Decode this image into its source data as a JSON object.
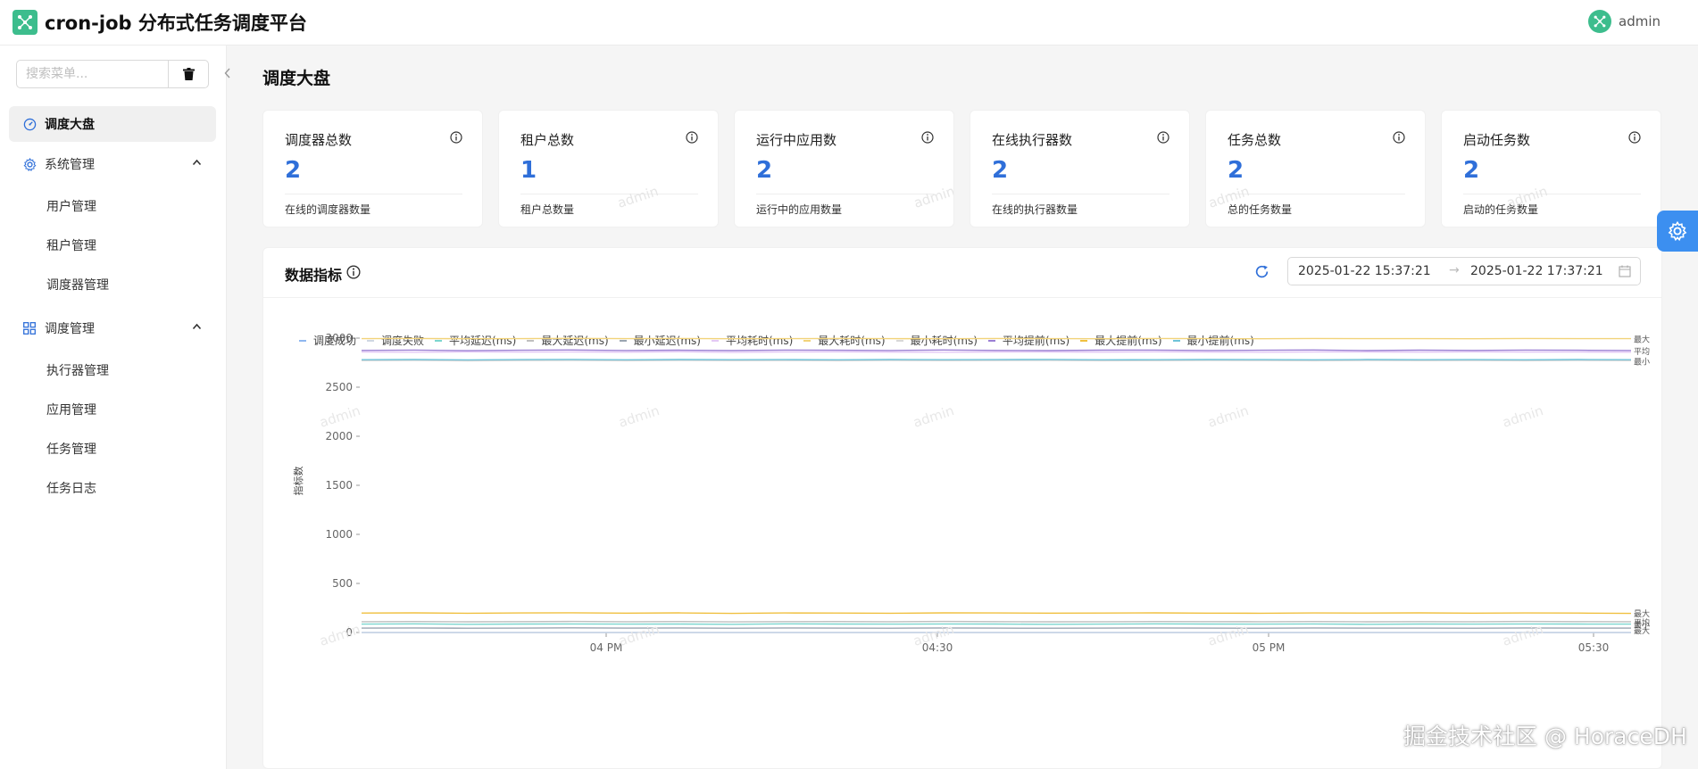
{
  "header": {
    "title": "cron-job 分布式任务调度平台",
    "user": "admin"
  },
  "sidebar": {
    "search_placeholder": "搜索菜单...",
    "items": [
      {
        "label": "调度大盘",
        "icon": "dashboard-icon",
        "active": true
      },
      {
        "label": "系统管理",
        "icon": "gear-icon",
        "expanded": true,
        "children": [
          "用户管理",
          "租户管理",
          "调度器管理"
        ]
      },
      {
        "label": "调度管理",
        "icon": "grid-icon",
        "expanded": true,
        "children": [
          "执行器管理",
          "应用管理",
          "任务管理",
          "任务日志"
        ]
      }
    ]
  },
  "page": {
    "title": "调度大盘"
  },
  "stat_cards": [
    {
      "title": "调度器总数",
      "value": "2",
      "desc": "在线的调度器数量"
    },
    {
      "title": "租户总数",
      "value": "1",
      "desc": "租户总数量"
    },
    {
      "title": "运行中应用数",
      "value": "2",
      "desc": "运行中的应用数量"
    },
    {
      "title": "在线执行器数",
      "value": "2",
      "desc": "在线的执行器数量"
    },
    {
      "title": "任务总数",
      "value": "2",
      "desc": "总的任务数量"
    },
    {
      "title": "启动任务数",
      "value": "2",
      "desc": "启动的任务数量"
    }
  ],
  "watermark": "admin",
  "metrics": {
    "title": "数据指标",
    "range_start": "2025-01-22 15:37:21",
    "range_separator": "→",
    "range_end": "2025-01-22 17:37:21"
  },
  "credit": "掘金技术社区 @ HoraceDH",
  "colors": {
    "accent": "#2f6fd9",
    "brand": "#3dbd8d",
    "fab": "#3c8ff0"
  },
  "chart_data": {
    "type": "line",
    "ylabel": "指标数",
    "ylim": [
      0,
      3000
    ],
    "yticks": [
      0,
      500,
      1000,
      1500,
      2000,
      2500,
      3000
    ],
    "xticks": [
      "04 PM",
      "04:30",
      "05 PM",
      "05:30"
    ],
    "x_range": [
      "2025-01-22 15:37:21",
      "2025-01-22 17:37:21"
    ],
    "legend_position": "top",
    "series": [
      {
        "name": "调度成功",
        "color": "#8fb7f0",
        "values": [
          0,
          0,
          0,
          0,
          0,
          0,
          0,
          0,
          0,
          0,
          0,
          0,
          0,
          0,
          0,
          0,
          0,
          0,
          0,
          0,
          0,
          0,
          0,
          0,
          0
        ]
      },
      {
        "name": "调度失败",
        "color": "#cfd7e3",
        "values": [
          0,
          0,
          0,
          0,
          0,
          0,
          0,
          0,
          0,
          0,
          0,
          0,
          0,
          0,
          0,
          0,
          0,
          0,
          0,
          0,
          0,
          0,
          0,
          0,
          0
        ]
      },
      {
        "name": "平均延迟(ms)",
        "color": "#7cd6cf",
        "values": [
          85,
          88,
          84,
          86,
          87,
          85,
          86,
          84,
          88,
          86,
          85,
          87,
          86,
          84,
          85,
          88,
          86,
          85,
          87,
          84,
          86,
          85,
          87,
          86,
          85
        ]
      },
      {
        "name": "最大延迟(ms)",
        "color": "#bfbfbf",
        "values": [
          110,
          112,
          109,
          111,
          113,
          110,
          112,
          108,
          111,
          112,
          110,
          113,
          111,
          109,
          110,
          112,
          111,
          110,
          112,
          109,
          111,
          110,
          113,
          111,
          110
        ]
      },
      {
        "name": "最小延迟(ms)",
        "color": "#9aa5b1",
        "values": [
          45,
          46,
          44,
          45,
          47,
          45,
          46,
          44,
          46,
          45,
          44,
          46,
          45,
          44,
          45,
          46,
          45,
          44,
          46,
          45,
          45,
          44,
          46,
          45,
          45
        ]
      },
      {
        "name": "平均耗时(ms)",
        "color": "#e4c9f5",
        "values": [
          2858,
          2855,
          2860,
          2857,
          2859,
          2856,
          2861,
          2854,
          2858,
          2860,
          2857,
          2855,
          2859,
          2858,
          2856,
          2860,
          2857,
          2855,
          2859,
          2858,
          2856,
          2860,
          2857,
          2858,
          2856
        ]
      },
      {
        "name": "最大耗时(ms)",
        "color": "#f2d37a",
        "values": [
          2995,
          2996,
          2994,
          2995,
          2997,
          2995,
          2996,
          2994,
          2995,
          2996,
          2995,
          2994,
          2996,
          2995,
          2994,
          2996,
          2995,
          2994,
          2996,
          2995,
          2995,
          2994,
          2996,
          2995,
          2995
        ]
      },
      {
        "name": "最小耗时(ms)",
        "color": "#d8d8d8",
        "values": [
          2770,
          2772,
          2768,
          2771,
          2773,
          2769,
          2772,
          2770,
          2771,
          2769,
          2772,
          2770,
          2771,
          2773,
          2769,
          2770,
          2772,
          2771,
          2769,
          2772,
          2770,
          2771,
          2769,
          2772,
          2770
        ]
      },
      {
        "name": "平均提前(ms)",
        "color": "#9b7fd4",
        "values": [
          2875,
          2878,
          2872,
          2876,
          2879,
          2874,
          2877,
          2873,
          2878,
          2876,
          2874,
          2879,
          2875,
          2873,
          2877,
          2878,
          2874,
          2876,
          2879,
          2873,
          2877,
          2875,
          2878,
          2876,
          2874
        ]
      },
      {
        "name": "最大提前(ms)",
        "color": "#f0c040",
        "values": [
          198,
          200,
          196,
          199,
          201,
          197,
          200,
          195,
          199,
          198,
          196,
          200,
          199,
          197,
          198,
          200,
          197,
          196,
          199,
          198,
          200,
          197,
          199,
          198,
          195
        ]
      },
      {
        "name": "最小提前(ms)",
        "color": "#6fc3d9",
        "values": [
          2780,
          2782,
          2778,
          2781,
          2783,
          2779,
          2782,
          2780,
          2781,
          2779,
          2782,
          2780,
          2781,
          2783,
          2779,
          2780,
          2782,
          2781,
          2779,
          2782,
          2780,
          2781,
          2779,
          2782,
          2780
        ]
      }
    ],
    "end_labels": [
      "最大",
      "平均",
      "最小",
      "最大",
      "平均",
      "最小",
      "最大"
    ]
  }
}
